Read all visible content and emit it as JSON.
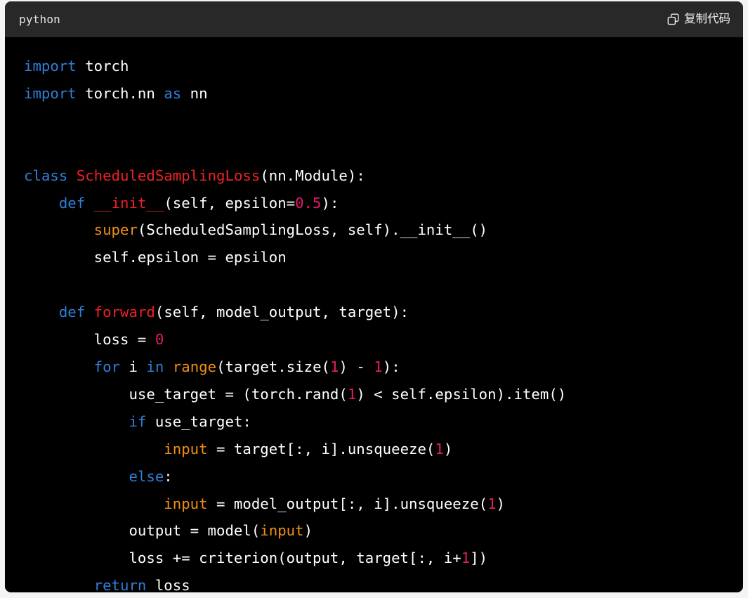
{
  "codeblock": {
    "language_label": "python",
    "copy_button_label": "复制代码",
    "copy_icon": "copy-icon",
    "colors": {
      "header_background": "#282828",
      "body_background": "#000000",
      "page_background": "#f4f4f4",
      "keyword": "#2f7fd8",
      "class_name": "#ee2225",
      "function_name": "#ee2225",
      "builtin": "#f08f14",
      "number": "#e5196b",
      "plain_text": "#ffffff"
    },
    "lines": [
      {
        "n": 1,
        "tokens": [
          {
            "t": "import",
            "c": "kw"
          },
          {
            "t": " torch",
            "c": "pl"
          }
        ]
      },
      {
        "n": 2,
        "tokens": [
          {
            "t": "import",
            "c": "kw"
          },
          {
            "t": " torch.nn ",
            "c": "pl"
          },
          {
            "t": "as",
            "c": "kw"
          },
          {
            "t": " nn",
            "c": "pl"
          }
        ]
      },
      {
        "n": 3,
        "tokens": []
      },
      {
        "n": 4,
        "tokens": []
      },
      {
        "n": 5,
        "tokens": [
          {
            "t": "class",
            "c": "kw"
          },
          {
            "t": " ",
            "c": "pl"
          },
          {
            "t": "ScheduledSamplingLoss",
            "c": "cls"
          },
          {
            "t": "(nn.Module):",
            "c": "pl"
          }
        ]
      },
      {
        "n": 6,
        "tokens": [
          {
            "t": "    ",
            "c": "pl"
          },
          {
            "t": "def",
            "c": "kw"
          },
          {
            "t": " ",
            "c": "pl"
          },
          {
            "t": "__init__",
            "c": "fn"
          },
          {
            "t": "(self, epsilon=",
            "c": "pl"
          },
          {
            "t": "0.5",
            "c": "num"
          },
          {
            "t": "):",
            "c": "pl"
          }
        ]
      },
      {
        "n": 7,
        "tokens": [
          {
            "t": "        ",
            "c": "pl"
          },
          {
            "t": "super",
            "c": "bi"
          },
          {
            "t": "(ScheduledSamplingLoss, self).__init__()",
            "c": "pl"
          }
        ]
      },
      {
        "n": 8,
        "tokens": [
          {
            "t": "        self.epsilon = epsilon",
            "c": "pl"
          }
        ]
      },
      {
        "n": 9,
        "tokens": []
      },
      {
        "n": 10,
        "tokens": [
          {
            "t": "    ",
            "c": "pl"
          },
          {
            "t": "def",
            "c": "kw"
          },
          {
            "t": " ",
            "c": "pl"
          },
          {
            "t": "forward",
            "c": "fn"
          },
          {
            "t": "(self, model_output, target):",
            "c": "pl"
          }
        ]
      },
      {
        "n": 11,
        "tokens": [
          {
            "t": "        loss = ",
            "c": "pl"
          },
          {
            "t": "0",
            "c": "num"
          }
        ]
      },
      {
        "n": 12,
        "tokens": [
          {
            "t": "        ",
            "c": "pl"
          },
          {
            "t": "for",
            "c": "kw"
          },
          {
            "t": " i ",
            "c": "pl"
          },
          {
            "t": "in",
            "c": "kw"
          },
          {
            "t": " ",
            "c": "pl"
          },
          {
            "t": "range",
            "c": "bi"
          },
          {
            "t": "(target.size(",
            "c": "pl"
          },
          {
            "t": "1",
            "c": "num"
          },
          {
            "t": ") - ",
            "c": "pl"
          },
          {
            "t": "1",
            "c": "num"
          },
          {
            "t": "):",
            "c": "pl"
          }
        ]
      },
      {
        "n": 13,
        "tokens": [
          {
            "t": "            use_target = (torch.rand(",
            "c": "pl"
          },
          {
            "t": "1",
            "c": "num"
          },
          {
            "t": ") < self.epsilon).item()",
            "c": "pl"
          }
        ]
      },
      {
        "n": 14,
        "tokens": [
          {
            "t": "            ",
            "c": "pl"
          },
          {
            "t": "if",
            "c": "kw"
          },
          {
            "t": " use_target:",
            "c": "pl"
          }
        ]
      },
      {
        "n": 15,
        "tokens": [
          {
            "t": "                ",
            "c": "pl"
          },
          {
            "t": "input",
            "c": "bi"
          },
          {
            "t": " = target[:, i].unsqueeze(",
            "c": "pl"
          },
          {
            "t": "1",
            "c": "num"
          },
          {
            "t": ")",
            "c": "pl"
          }
        ]
      },
      {
        "n": 16,
        "tokens": [
          {
            "t": "            ",
            "c": "pl"
          },
          {
            "t": "else",
            "c": "kw"
          },
          {
            "t": ":",
            "c": "pl"
          }
        ]
      },
      {
        "n": 17,
        "tokens": [
          {
            "t": "                ",
            "c": "pl"
          },
          {
            "t": "input",
            "c": "bi"
          },
          {
            "t": " = model_output[:, i].unsqueeze(",
            "c": "pl"
          },
          {
            "t": "1",
            "c": "num"
          },
          {
            "t": ")",
            "c": "pl"
          }
        ]
      },
      {
        "n": 18,
        "tokens": [
          {
            "t": "            output = model(",
            "c": "pl"
          },
          {
            "t": "input",
            "c": "bi"
          },
          {
            "t": ")",
            "c": "pl"
          }
        ]
      },
      {
        "n": 19,
        "tokens": [
          {
            "t": "            loss += criterion(output, target[:, i+",
            "c": "pl"
          },
          {
            "t": "1",
            "c": "num"
          },
          {
            "t": "])",
            "c": "pl"
          }
        ]
      },
      {
        "n": 20,
        "tokens": [
          {
            "t": "        ",
            "c": "pl"
          },
          {
            "t": "return",
            "c": "kw"
          },
          {
            "t": " loss",
            "c": "pl"
          }
        ]
      }
    ]
  }
}
